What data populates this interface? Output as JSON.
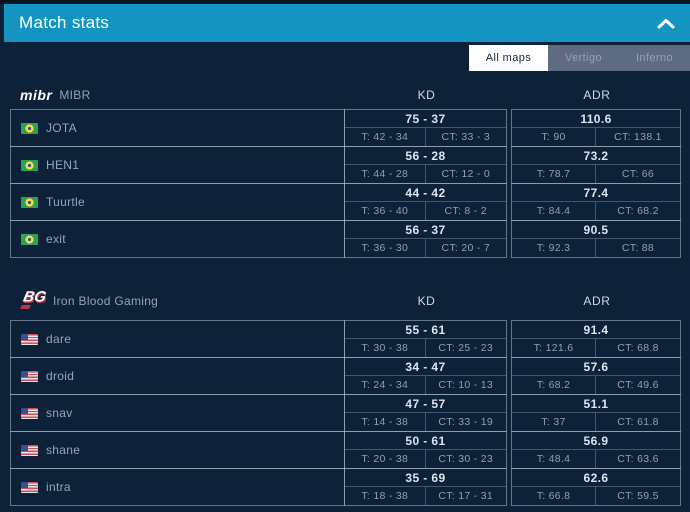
{
  "colors": {
    "accent_teal": "#1494c0",
    "page_bg": "#0d2138",
    "active_tab_bg": "#ffffff",
    "inactive_tab_bg": "#5d6c80",
    "cell_border": "#b0bdcb"
  },
  "header": {
    "title": "Match stats",
    "collapse_icon": "chevron-up"
  },
  "tabs": [
    {
      "label": "All maps",
      "active": true
    },
    {
      "label": "Vertigo",
      "active": false
    },
    {
      "label": "Inferno",
      "active": false
    }
  ],
  "columns": {
    "kd": "KD",
    "adr": "ADR"
  },
  "teams": [
    {
      "name": "MIBR",
      "logo": "mibr-wordmark",
      "logo_text": "mibr",
      "players": [
        {
          "flag": "br",
          "name": "JOTA",
          "kd": "75 - 37",
          "kd_t": "T: 42 - 34",
          "kd_ct": "CT: 33 - 3",
          "adr": "110.6",
          "adr_t": "T: 90",
          "adr_ct": "CT: 138.1"
        },
        {
          "flag": "br",
          "name": "HEN1",
          "kd": "56 - 28",
          "kd_t": "T: 44 - 28",
          "kd_ct": "CT: 12 - 0",
          "adr": "73.2",
          "adr_t": "T: 78.7",
          "adr_ct": "CT: 66"
        },
        {
          "flag": "br",
          "name": "Tuurtle",
          "kd": "44 - 42",
          "kd_t": "T: 36 - 40",
          "kd_ct": "CT: 8 - 2",
          "adr": "77.4",
          "adr_t": "T: 84.4",
          "adr_ct": "CT: 68.2"
        },
        {
          "flag": "br",
          "name": "exit",
          "kd": "56 - 37",
          "kd_t": "T: 36 - 30",
          "kd_ct": "CT: 20 - 7",
          "adr": "90.5",
          "adr_t": "T: 92.3",
          "adr_ct": "CT: 88"
        }
      ]
    },
    {
      "name": "Iron Blood Gaming",
      "logo": "iron-blood-gaming-logo",
      "players": [
        {
          "flag": "us",
          "name": "dare",
          "kd": "55 - 61",
          "kd_t": "T: 30 - 38",
          "kd_ct": "CT: 25 - 23",
          "adr": "91.4",
          "adr_t": "T: 121.6",
          "adr_ct": "CT: 68.8"
        },
        {
          "flag": "us",
          "name": "droid",
          "kd": "34 - 47",
          "kd_t": "T: 24 - 34",
          "kd_ct": "CT: 10 - 13",
          "adr": "57.6",
          "adr_t": "T: 68.2",
          "adr_ct": "CT: 49.6"
        },
        {
          "flag": "us",
          "name": "snav",
          "kd": "47 - 57",
          "kd_t": "T: 14 - 38",
          "kd_ct": "CT: 33 - 19",
          "adr": "51.1",
          "adr_t": "T: 37",
          "adr_ct": "CT: 61.8"
        },
        {
          "flag": "us",
          "name": "shane",
          "kd": "50 - 61",
          "kd_t": "T: 20 - 38",
          "kd_ct": "CT: 30 - 23",
          "adr": "56.9",
          "adr_t": "T: 48.4",
          "adr_ct": "CT: 63.6"
        },
        {
          "flag": "us",
          "name": "intra",
          "kd": "35 - 69",
          "kd_t": "T: 18 - 38",
          "kd_ct": "CT: 17 - 31",
          "adr": "62.6",
          "adr_t": "T: 66.8",
          "adr_ct": "CT: 59.5"
        }
      ]
    }
  ]
}
